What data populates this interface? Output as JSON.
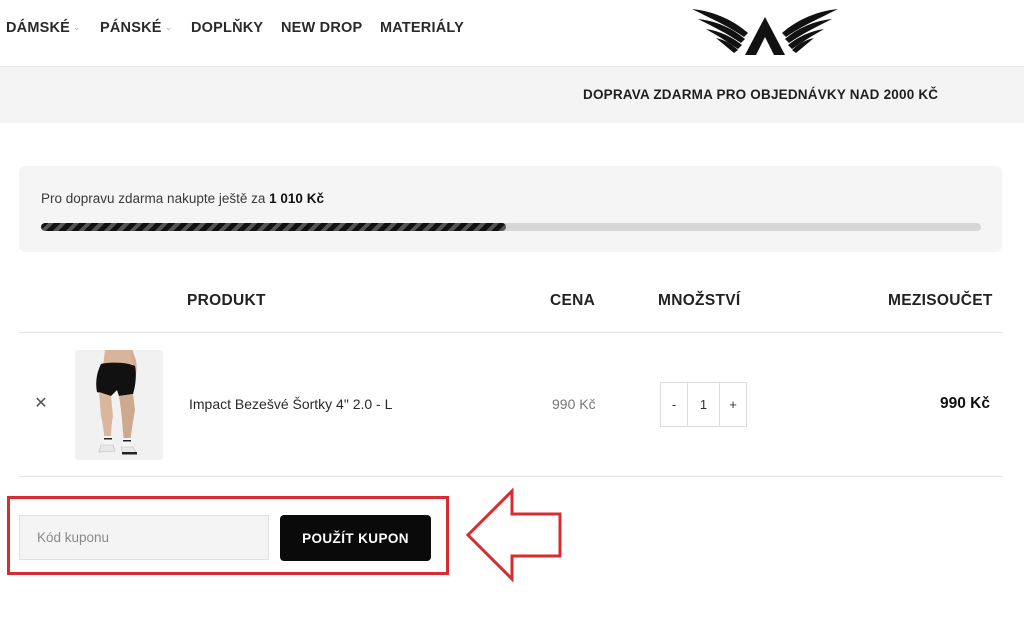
{
  "nav": {
    "items": [
      {
        "label": "DÁMSKÉ",
        "has_dropdown": true
      },
      {
        "label": "PÁNSKÉ",
        "has_dropdown": true
      },
      {
        "label": "DOPLŇKY",
        "has_dropdown": false
      },
      {
        "label": "NEW DROP",
        "has_dropdown": false
      },
      {
        "label": "MATERIÁLY",
        "has_dropdown": false
      }
    ],
    "dropdown_icon": "chevron-down-icon",
    "logo_icon": "winged-a-logo"
  },
  "banner": {
    "text": "DOPRAVA ZDARMA PRO OBJEDNÁVKY NAD 2000 KČ"
  },
  "free_shipping": {
    "text_prefix": "Pro dopravu zdarma nakupte ještě za",
    "amount": "1 010 Kč",
    "progress_fraction": 0.495
  },
  "cart_table": {
    "headers": {
      "product": "PRODUKT",
      "price": "CENA",
      "quantity": "MNOŽSTVÍ",
      "subtotal": "MEZISOUČET"
    },
    "rows": [
      {
        "remove_icon": "close-icon",
        "name": "Impact Bezešvé Šortky 4\" 2.0 - L",
        "price": "990 Kč",
        "qty_minus": "-",
        "quantity": "1",
        "qty_plus": "+",
        "subtotal": "990 Kč"
      }
    ]
  },
  "coupon": {
    "placeholder": "Kód kuponu",
    "button_label": "POUŽÍT KUPON"
  },
  "annotation": {
    "color": "#d62d33",
    "arrow_icon": "left-arrow-outline-icon"
  }
}
